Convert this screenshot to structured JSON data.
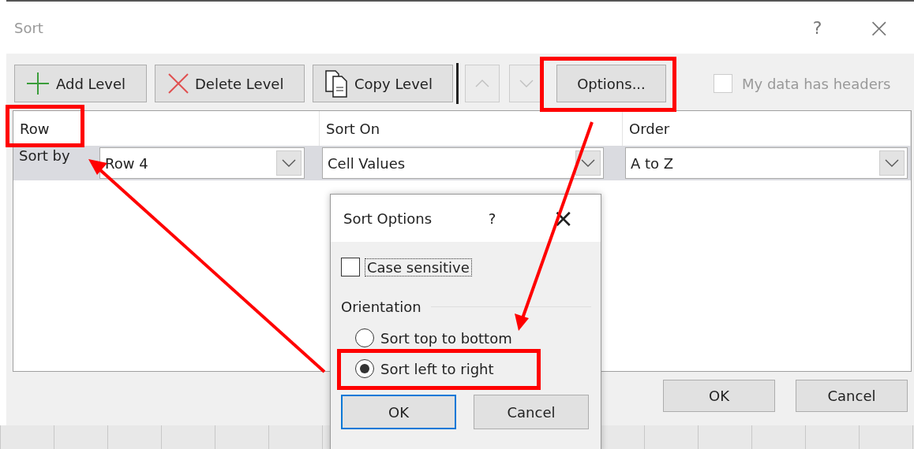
{
  "window": {
    "title": "Sort",
    "help": "?",
    "close": "×"
  },
  "toolbar": {
    "buttons": [
      {
        "kind": "add",
        "label": "Add Level",
        "disabled": false
      },
      {
        "kind": "delete",
        "label": "Delete Level",
        "disabled": false
      },
      {
        "kind": "copy",
        "label": "Copy Level",
        "disabled": false
      },
      {
        "kind": "up",
        "disabled": true
      },
      {
        "kind": "down",
        "disabled": true
      },
      {
        "kind": "text",
        "label": "Options...",
        "disabled": false
      }
    ],
    "headers_checkbox": {
      "label": "My data has headers",
      "checked": false,
      "disabled": true
    }
  },
  "table": {
    "columns": [
      "Row",
      "Sort On",
      "Order"
    ],
    "rows": [
      {
        "label": "Sort by",
        "selected": true,
        "row": "Row 4",
        "sort_on": "Cell Values",
        "order": "A to Z"
      }
    ]
  },
  "buttons": [
    "OK",
    "Cancel"
  ],
  "options_dialog": {
    "title": "Sort Options",
    "help": "?",
    "close": "×",
    "case_sensitive": {
      "label": "Case sensitive",
      "checked": false
    },
    "orientation_label": "Orientation",
    "orientation": [
      {
        "label": "Sort top to bottom",
        "selected": false
      },
      {
        "label": "Sort left to right",
        "selected": true
      }
    ],
    "buttons": [
      {
        "label": "OK",
        "default": true
      },
      {
        "label": "Cancel",
        "default": false
      }
    ]
  }
}
